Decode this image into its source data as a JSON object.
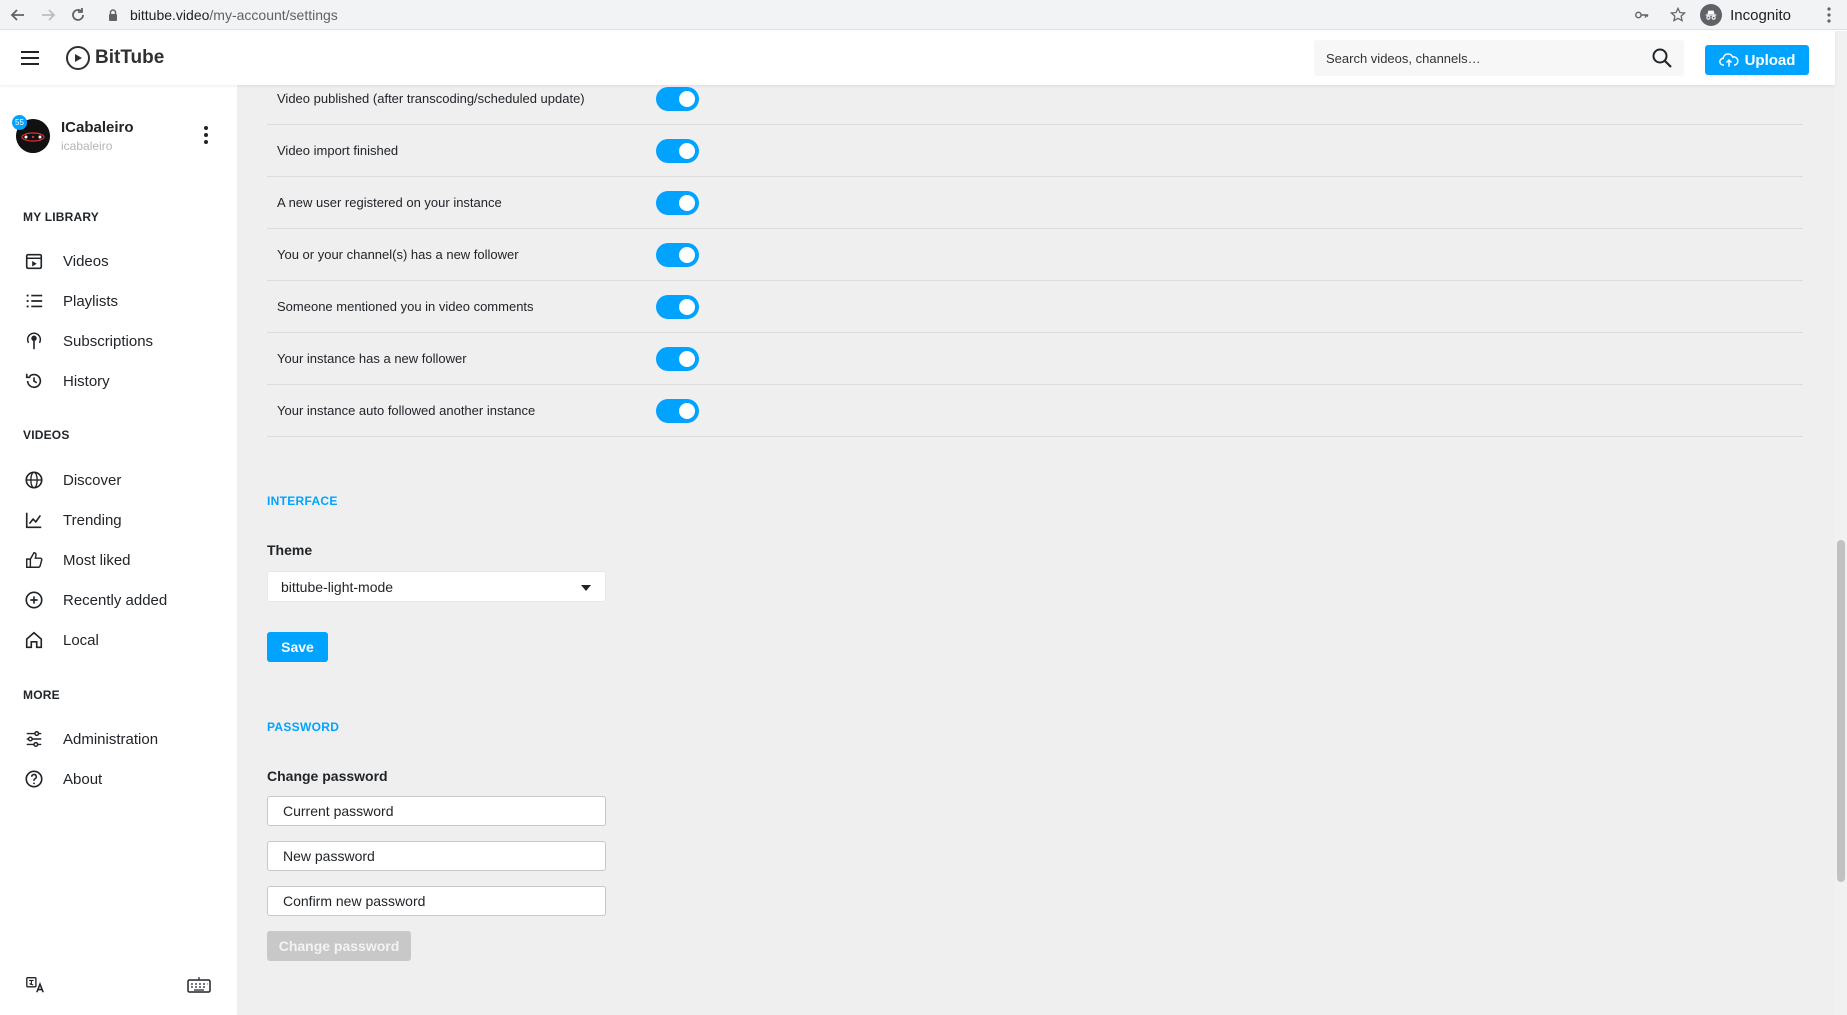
{
  "browser": {
    "url_host": "bittube.video",
    "url_path": "/my-account/settings",
    "profile_label": "Incognito"
  },
  "header": {
    "brand": "BitTube",
    "search_placeholder": "Search videos, channels…",
    "upload_label": "Upload"
  },
  "user": {
    "name": "ICabaleiro",
    "handle": "icabaleiro",
    "badge": "55"
  },
  "sidebar": {
    "library_title": "MY LIBRARY",
    "library_items": [
      {
        "label": "Videos",
        "icon": "videos-icon"
      },
      {
        "label": "Playlists",
        "icon": "playlists-icon"
      },
      {
        "label": "Subscriptions",
        "icon": "subscriptions-icon"
      },
      {
        "label": "History",
        "icon": "history-icon"
      }
    ],
    "videos_title": "VIDEOS",
    "videos_items": [
      {
        "label": "Discover",
        "icon": "globe-icon"
      },
      {
        "label": "Trending",
        "icon": "trending-icon"
      },
      {
        "label": "Most liked",
        "icon": "thumbs-up-icon"
      },
      {
        "label": "Recently added",
        "icon": "plus-circle-icon"
      },
      {
        "label": "Local",
        "icon": "home-icon"
      }
    ],
    "more_title": "MORE",
    "more_items": [
      {
        "label": "Administration",
        "icon": "sliders-icon"
      },
      {
        "label": "About",
        "icon": "help-icon"
      }
    ]
  },
  "notifications": [
    {
      "label": "Video published (after transcoding/scheduled update)",
      "enabled": true
    },
    {
      "label": "Video import finished",
      "enabled": true
    },
    {
      "label": "A new user registered on your instance",
      "enabled": true
    },
    {
      "label": "You or your channel(s) has a new follower",
      "enabled": true
    },
    {
      "label": "Someone mentioned you in video comments",
      "enabled": true
    },
    {
      "label": "Your instance has a new follower",
      "enabled": true
    },
    {
      "label": "Your instance auto followed another instance",
      "enabled": true
    }
  ],
  "interface": {
    "section_title": "INTERFACE",
    "theme_label": "Theme",
    "theme_value": "bittube-light-mode",
    "save_label": "Save"
  },
  "password": {
    "section_title": "PASSWORD",
    "change_label": "Change password",
    "current_placeholder": "Current password",
    "new_placeholder": "New password",
    "confirm_placeholder": "Confirm new password",
    "submit_label": "Change password"
  },
  "colors": {
    "accent": "#00a3ff",
    "main_bg": "#f0eff0"
  }
}
